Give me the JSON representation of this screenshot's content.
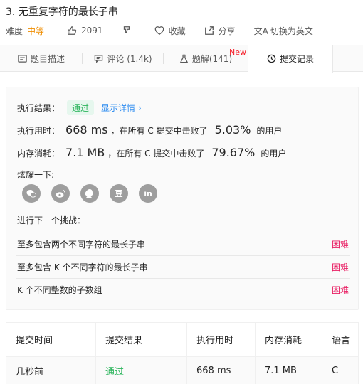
{
  "problem": {
    "title": "3. 无重复字符的最长子串",
    "difficulty_label": "难度",
    "difficulty_value": "中等",
    "likes": "2091",
    "favorite_label": "收藏",
    "share_label": "分享",
    "switch_lang_label": "切换为英文"
  },
  "tabs": [
    {
      "label": "题目描述",
      "icon": "description-icon"
    },
    {
      "label": "评论 (1.4k)",
      "icon": "comment-icon"
    },
    {
      "label": "题解(141)",
      "icon": "flask-icon",
      "badge": "New"
    },
    {
      "label": "提交记录",
      "icon": "clock-icon"
    }
  ],
  "result": {
    "result_label": "执行结果：",
    "status": "通过",
    "detail_link": "显示详情 ›",
    "runtime_label": "执行用时：",
    "runtime_value": "668 ms",
    "runtime_mid": "，在所有 C 提交中击败了",
    "runtime_pct": "5.03%",
    "runtime_tail": "的用户",
    "memory_label": "内存消耗：",
    "memory_value": "7.1 MB",
    "memory_mid": "，在所有 C 提交中击败了",
    "memory_pct": "79.67%",
    "memory_tail": "的用户",
    "share_label": "炫耀一下:",
    "share_icons": [
      "wechat-icon",
      "weibo-icon",
      "qq-icon",
      "douban-icon",
      "linkedin-icon"
    ],
    "douban_text": "豆",
    "linkedin_text": "in",
    "next_label": "进行下一个挑战：",
    "challenges": [
      {
        "title": "至多包含两个不同字符的最长子串",
        "difficulty": "困难"
      },
      {
        "title": "至多包含 K 个不同字符的最长子串",
        "difficulty": "困难"
      },
      {
        "title": "K 个不同整数的子数组",
        "difficulty": "困难"
      }
    ]
  },
  "submissions": {
    "headers": [
      "提交时间",
      "提交结果",
      "执行用时",
      "内存消耗",
      "语言"
    ],
    "rows": [
      {
        "time": "几秒前",
        "result": "通过",
        "runtime": "668 ms",
        "memory": "7.1 MB",
        "language": "C"
      }
    ]
  },
  "colors": {
    "accent_green": "#2db55d",
    "medium_orange": "#ef8d00",
    "hard_pink": "#e91e63",
    "link_blue": "#2d8cf0"
  }
}
